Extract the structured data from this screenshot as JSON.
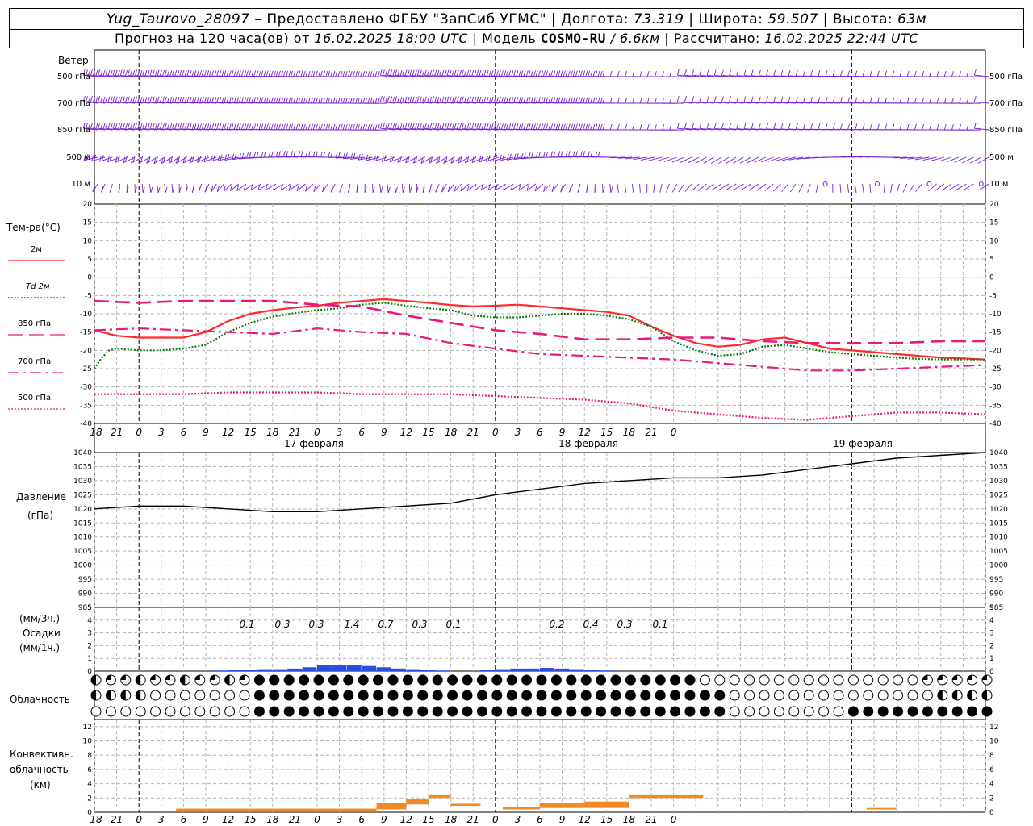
{
  "header": {
    "station": "Yug_Taurovo_28097",
    "provider": "– Предоставлено ФГБУ \"ЗапСиб УГМС\"",
    "lon_label": "Долгота:",
    "lon": "73.319",
    "lat_label": "Широта:",
    "lat": "59.507",
    "alt_label": "Высота:",
    "alt": "63м",
    "forecast_prefix": "Прогноз на 120 часа(ов) от",
    "forecast_time": "16.02.2025 18:00 UTC",
    "model_label": "| Модель",
    "model": "COSMO-RU",
    "model_res": "/ 6.6км",
    "calc_label": "| Рассчитано:",
    "calc_time": "16.02.2025 22:44 UTC"
  },
  "wind_panel": {
    "title": "Ветер",
    "levels": [
      "500 гПа",
      "700 гПа",
      "850 гПа",
      "500 м",
      "10  м"
    ],
    "barb_color": "#7a1fd6"
  },
  "temp_panel": {
    "title": "Тем-ра(°C)",
    "legend": [
      {
        "label": "2м",
        "color": "#ff2a2a",
        "style": "solid"
      },
      {
        "label": "Td  2м",
        "color": "#0a7a0a",
        "style": "dotted"
      },
      {
        "label": "850 гПа",
        "color": "#e8197a",
        "style": "longdash"
      },
      {
        "label": "700 гПа",
        "color": "#e8197a",
        "style": "dashdot"
      },
      {
        "label": "500 гПа",
        "color": "#e8197a",
        "style": "dotted"
      }
    ],
    "ticks": [
      "20",
      "15",
      "10",
      "5",
      "0",
      "-5",
      "-10",
      "-15",
      "-20",
      "-25",
      "-30",
      "-35",
      "-40"
    ]
  },
  "pressure_panel": {
    "title1": "Давление",
    "title2": "(гПа)",
    "ticks": [
      "1040",
      "1035",
      "1030",
      "1025",
      "1020",
      "1015",
      "1010",
      "1005",
      "1000",
      "995",
      "990",
      "985"
    ]
  },
  "precip_panel": {
    "title1": "(мм/3ч.)",
    "title2": "Осадки",
    "title3": "(мм/1ч.)",
    "ticks": [
      "5",
      "4",
      "3",
      "2",
      "1",
      "0"
    ],
    "amounts_3h": [
      "0.1",
      "0.3",
      "0.3",
      "1.4",
      "0.7",
      "0.3",
      "0.1",
      "0.2",
      "0.4",
      "0.3",
      "0.1"
    ]
  },
  "cloud_panel": {
    "title": "Облачность"
  },
  "conv_panel": {
    "title1": "Конвективн.",
    "title2": "облачность",
    "title3": "(км)",
    "ticks": [
      "12",
      "10",
      "8",
      "6",
      "4",
      "2",
      "0"
    ]
  },
  "time_axis": {
    "hour_labels": [
      "18",
      "21",
      "0",
      "3",
      "6",
      "9",
      "12",
      "15",
      "18",
      "21",
      "0",
      "3",
      "6",
      "9",
      "12",
      "15",
      "18",
      "21",
      "0",
      "3",
      "6",
      "9",
      "12",
      "15",
      "18",
      "21",
      "0"
    ],
    "day_labels": [
      "17 февраля",
      "18 февраля",
      "19 февраля"
    ]
  },
  "chart_data": [
    {
      "type": "line",
      "title": "Тем-ра(°C)",
      "x_unit": "hours since 16.02.2025 18:00 UTC",
      "ylim": [
        -40,
        20
      ],
      "series": [
        {
          "name": "2м",
          "x": [
            0,
            3,
            6,
            9,
            12,
            15,
            18,
            21,
            24,
            27,
            30,
            33,
            36,
            39,
            42,
            45,
            48,
            51,
            54,
            57,
            60,
            63,
            66,
            69,
            72,
            75,
            78,
            81,
            84,
            87,
            90,
            93,
            96,
            99,
            102,
            105,
            108,
            111,
            114,
            117,
            120
          ],
          "values": [
            -14.5,
            -16,
            -16.5,
            -16.5,
            -16.5,
            -15,
            -12,
            -10,
            -9,
            -8.3,
            -7.8,
            -7,
            -6.5,
            -6,
            -6.5,
            -7,
            -7.6,
            -8,
            -7.8,
            -7.5,
            -8,
            -8.5,
            -9,
            -9.5,
            -10.5,
            -13.5,
            -16,
            -18,
            -19,
            -18.5,
            -17,
            -16.5,
            -18,
            -19.5,
            -20,
            -20.5,
            -21,
            -21.5,
            -22,
            -22.2,
            -22.5
          ]
        },
        {
          "name": "Td  2м",
          "x": [
            0,
            1,
            2,
            3,
            6,
            9,
            12,
            15,
            18,
            21,
            24,
            27,
            30,
            33,
            36,
            39,
            42,
            45,
            48,
            51,
            54,
            57,
            60,
            63,
            66,
            69,
            72,
            75,
            78,
            81,
            84,
            87,
            90,
            93,
            96,
            99,
            102,
            105,
            108,
            111,
            114,
            117,
            120
          ],
          "values": [
            -25,
            -22,
            -20,
            -19.5,
            -20,
            -20,
            -19.5,
            -18.5,
            -15,
            -12.5,
            -10.8,
            -9.8,
            -9,
            -8.5,
            -7.5,
            -7,
            -7.8,
            -8.5,
            -9,
            -10.5,
            -11,
            -11,
            -10.5,
            -10,
            -10,
            -10.5,
            -11.5,
            -13.5,
            -17.5,
            -20,
            -21.5,
            -21,
            -19,
            -18.5,
            -19.5,
            -20.5,
            -21,
            -21.5,
            -22,
            -22.3,
            -22.5,
            -22.5,
            -22.5
          ]
        },
        {
          "name": "850 гПа",
          "x": [
            0,
            6,
            12,
            18,
            24,
            30,
            36,
            42,
            48,
            54,
            60,
            66,
            72,
            78,
            84,
            90,
            96,
            102,
            108,
            114,
            120
          ],
          "values": [
            -6.5,
            -7,
            -6.5,
            -6.5,
            -6.5,
            -7.5,
            -8,
            -10.5,
            -12.5,
            -14.5,
            -15.5,
            -17,
            -17,
            -16.5,
            -16.5,
            -17.5,
            -18,
            -18,
            -18,
            -17.5,
            -17.5
          ]
        },
        {
          "name": "700 гПа",
          "x": [
            0,
            6,
            12,
            18,
            24,
            30,
            36,
            42,
            48,
            54,
            60,
            66,
            72,
            78,
            84,
            90,
            96,
            102,
            108,
            114,
            120
          ],
          "values": [
            -14.5,
            -14,
            -14.5,
            -15,
            -15.5,
            -14,
            -15,
            -15.5,
            -18,
            -19.5,
            -21,
            -21.5,
            -22,
            -22.5,
            -23.5,
            -24.5,
            -25.5,
            -25.5,
            -25,
            -24.5,
            -24
          ]
        },
        {
          "name": "500 гПа",
          "x": [
            0,
            6,
            12,
            18,
            24,
            30,
            36,
            42,
            48,
            54,
            60,
            66,
            72,
            78,
            84,
            90,
            96,
            102,
            108,
            114,
            120
          ],
          "values": [
            -32,
            -32,
            -32,
            -31.5,
            -31.5,
            -31.5,
            -32,
            -32,
            -32,
            -32.5,
            -33,
            -33.5,
            -34.5,
            -36.5,
            -37.5,
            -38.5,
            -39,
            -38,
            -37,
            -37,
            -37.5
          ]
        }
      ]
    },
    {
      "type": "line",
      "title": "Давление",
      "x_unit": "hours since 16.02.2025 18:00 UTC",
      "ylim": [
        985,
        1040
      ],
      "series": [
        {
          "name": "",
          "x": [
            0,
            6,
            12,
            18,
            24,
            30,
            36,
            42,
            48,
            54,
            60,
            66,
            72,
            78,
            84,
            90,
            96,
            102,
            108,
            114,
            120
          ],
          "values": [
            1020,
            1021,
            1021,
            1020,
            1019,
            1019,
            1020,
            1021,
            1022,
            1025,
            1027,
            1029,
            1030,
            1031,
            1031,
            1032,
            1034,
            1036,
            1038,
            1039,
            1040
          ]
        }
      ]
    },
    {
      "type": "bar",
      "title": "Осадки",
      "x_unit": "hours since 16.02.2025 18:00 UTC",
      "ylim": [
        0,
        5
      ],
      "x": [
        17,
        19,
        21,
        23,
        25,
        27,
        29,
        31,
        33,
        35,
        37,
        39,
        41,
        43,
        45,
        47,
        49,
        51,
        53,
        55,
        57,
        59,
        61,
        63,
        65,
        67,
        69
      ],
      "values": [
        0.05,
        0.1,
        0.1,
        0.15,
        0.15,
        0.2,
        0.3,
        0.5,
        0.5,
        0.5,
        0.4,
        0.3,
        0.2,
        0.15,
        0.1,
        0.05,
        0,
        0,
        0.1,
        0.15,
        0.2,
        0.2,
        0.25,
        0.2,
        0.15,
        0.1,
        0.05
      ]
    },
    {
      "type": "bar",
      "title": "Конвективн. облачность",
      "x_unit": "hours since 16.02.2025 18:00 UTC",
      "ylim": [
        0,
        13
      ],
      "bars": [
        {
          "x0": 11,
          "x1": 38,
          "bottom": 0.2,
          "top": 0.5
        },
        {
          "x0": 38,
          "x1": 42,
          "bottom": 0.4,
          "top": 1.3
        },
        {
          "x0": 42,
          "x1": 45,
          "bottom": 1.1,
          "top": 1.8
        },
        {
          "x0": 45,
          "x1": 48,
          "bottom": 2.0,
          "top": 2.5
        },
        {
          "x0": 48,
          "x1": 52,
          "bottom": 0.9,
          "top": 1.2
        },
        {
          "x0": 55,
          "x1": 60,
          "bottom": 0.4,
          "top": 0.7
        },
        {
          "x0": 60,
          "x1": 66,
          "bottom": 0.6,
          "top": 1.3
        },
        {
          "x0": 66,
          "x1": 72,
          "bottom": 0.6,
          "top": 1.5
        },
        {
          "x0": 72,
          "x1": 82,
          "bottom": 2.0,
          "top": 2.5
        },
        {
          "x0": 104,
          "x1": 108,
          "bottom": 0.4,
          "top": 0.6
        }
      ]
    }
  ]
}
